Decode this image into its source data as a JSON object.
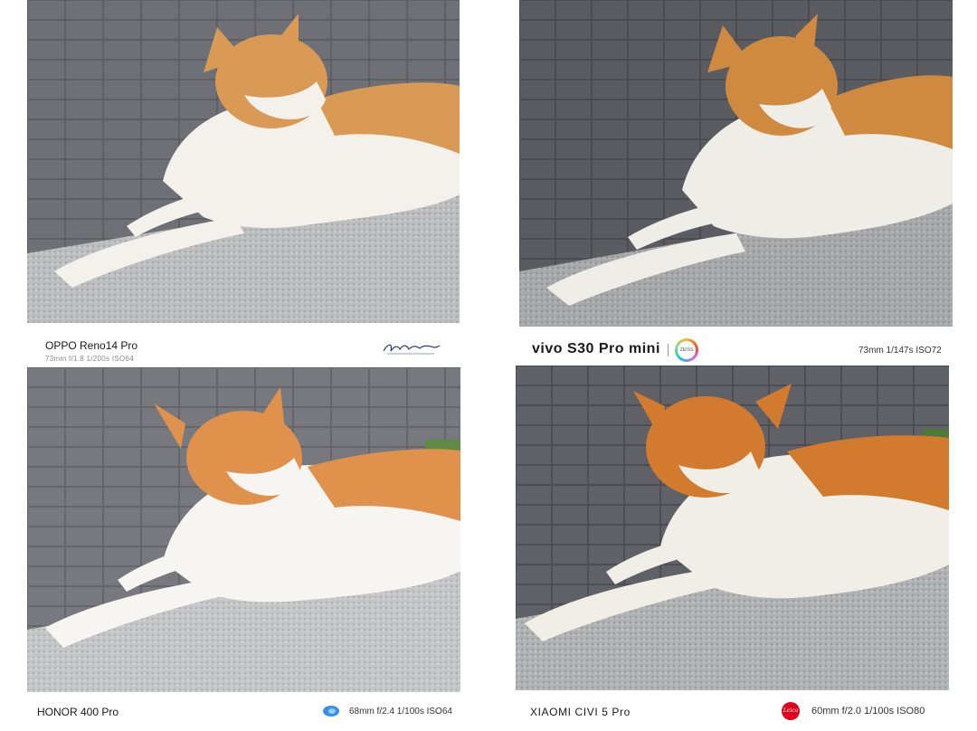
{
  "panels": [
    {
      "model": "OPPO Reno14 Pro",
      "specs": "73mm  f/1.8  1/200s  ISO64",
      "signature_text": "Lewtraktophoto",
      "tone": {
        "bg": "#5f6166",
        "tile": "#6c6f74",
        "granite": "#bfc0c1",
        "orange": "#d99a55",
        "white": "#f4f1ec"
      }
    },
    {
      "model": "vivo S30 Pro mini",
      "brand_badge": "ZEISS",
      "specs": "73mm  1/147s  ISO72",
      "tone": {
        "bg": "#4e5054",
        "tile": "#5b5d62",
        "granite": "#a9aaac",
        "orange": "#cf8a3f",
        "white": "#efede7"
      }
    },
    {
      "model": "HONOR 400 Pro",
      "specs": "68mm  f/2.4  1/100s  ISO64",
      "brand_icon": "honor-ai-icon",
      "tone": {
        "bg": "#6a6c71",
        "tile": "#76787d",
        "granite": "#c6c7c8",
        "orange": "#e0914c",
        "white": "#f7f5f1"
      }
    },
    {
      "model": "XIAOMI CIVI 5 Pro",
      "specs": "60mm  f/2.0  1/100s  ISO80",
      "brand_badge": "Leica",
      "brand_icon": "leica-red-dot-icon",
      "tone": {
        "bg": "#505258",
        "tile": "#5e6066",
        "granite": "#b3b4b5",
        "orange": "#d27a2e",
        "white": "#f1eee8"
      }
    }
  ]
}
